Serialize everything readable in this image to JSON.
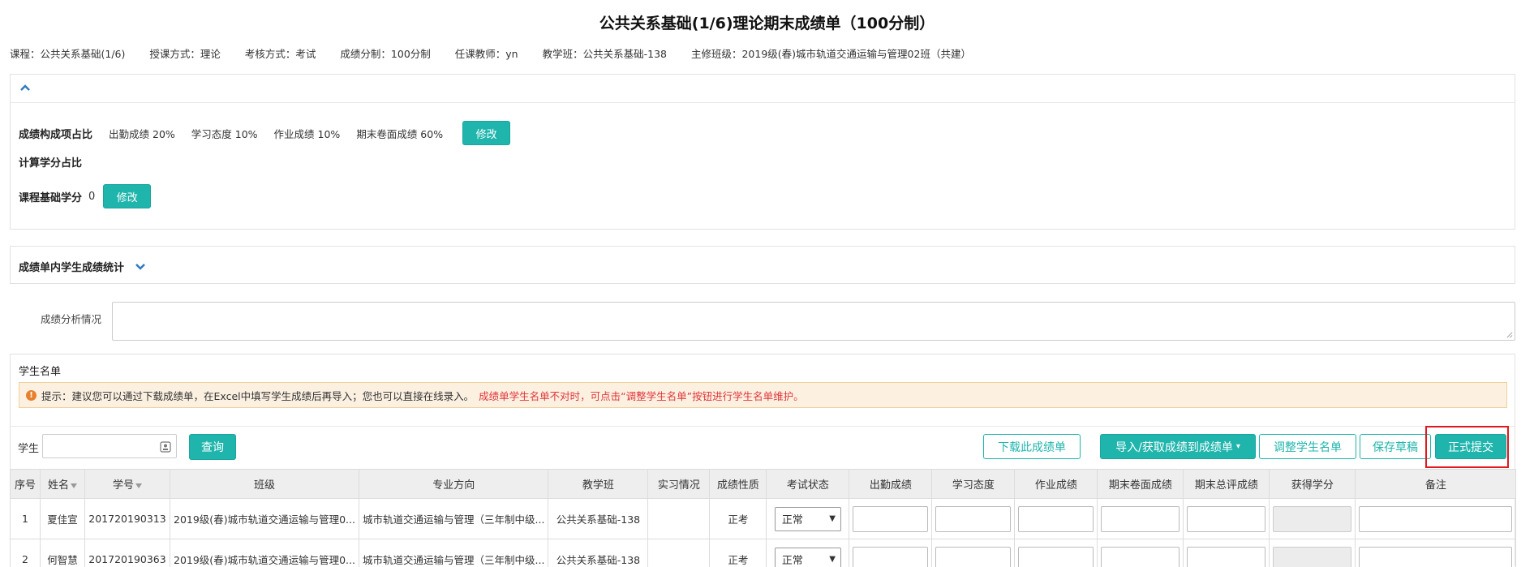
{
  "title": "公共关系基础(1/6)理论期末成绩单（100分制）",
  "info": [
    {
      "label": "课程：",
      "value": "公共关系基础(1/6)"
    },
    {
      "label": "授课方式：",
      "value": "理论"
    },
    {
      "label": "考核方式：",
      "value": "考试"
    },
    {
      "label": "成绩分制：",
      "value": "100分制"
    },
    {
      "label": "任课教师：",
      "value": "yn"
    },
    {
      "label": "教学班：",
      "value": "公共关系基础-138"
    },
    {
      "label": "主修班级：",
      "value": "2019级(春)城市轨道交通运输与管理02班（共建）"
    }
  ],
  "composition": {
    "label": "成绩构成项占比",
    "items": [
      "出勤成绩 20%",
      "学习态度 10%",
      "作业成绩 10%",
      "期末卷面成绩 60%"
    ],
    "edit_label": "修改"
  },
  "credit": {
    "calc_label": "计算学分占比",
    "base_label": "课程基础学分",
    "base_value": "0",
    "edit_label": "修改"
  },
  "stats": {
    "label": "成绩单内学生成绩统计"
  },
  "analysis": {
    "label": "成绩分析情况",
    "value": ""
  },
  "roster": {
    "label": "学生名单",
    "tip_prefix": "提示：建议您可以通过下载成绩单，在Excel中填写学生成绩后再导入；您也可以直接在线录入。",
    "tip_red": "成绩单学生名单不对时，可点击“调整学生名单”按钮进行学生名单维护。"
  },
  "search": {
    "label": "学生",
    "placeholder": "",
    "button": "查询"
  },
  "toolbar": {
    "download": "下载此成绩单",
    "import": "导入/获取成绩到成绩单",
    "adjust": "调整学生名单",
    "save_draft": "保存草稿",
    "submit": "正式提交"
  },
  "table": {
    "headers": [
      "序号",
      "姓名",
      "学号",
      "班级",
      "专业方向",
      "教学班",
      "实习情况",
      "成绩性质",
      "考试状态",
      "出勤成绩",
      "学习态度",
      "作业成绩",
      "期末卷面成绩",
      "期末总评成绩",
      "获得学分",
      "备注"
    ],
    "rows": [
      {
        "no": "1",
        "name": "夏佳宣",
        "id": "201720190313",
        "class": "2019级(春)城市轨道交通运输与管理0...",
        "major": "城市轨道交通运输与管理（三年制中级...",
        "teach_class": "公共关系基础-138",
        "intern": "",
        "nature": "正考",
        "status": "正常"
      },
      {
        "no": "2",
        "name": "何智慧",
        "id": "201720190363",
        "class": "2019级(春)城市轨道交通运输与管理0...",
        "major": "城市轨道交通运输与管理（三年制中级...",
        "teach_class": "公共关系基础-138",
        "intern": "",
        "nature": "正考",
        "status": "正常"
      }
    ]
  },
  "colors": {
    "accent": "#1fb5ac",
    "alert_bg": "#fcf1e1",
    "alert_red": "#e0353a",
    "highlight": "#e0191f"
  }
}
